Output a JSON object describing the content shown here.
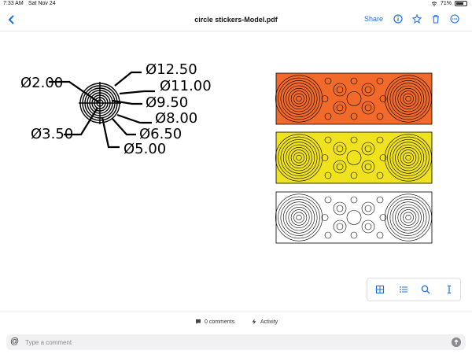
{
  "status_bar": {
    "time": "7:33 AM",
    "date": "Sat Nov 24",
    "battery": "71%",
    "battery_level": 0.71
  },
  "nav": {
    "title": "circle stickers-Model.pdf",
    "share_label": "Share"
  },
  "drawing": {
    "diameters": [
      "Ø2.00",
      "Ø3.50",
      "Ø5.00",
      "Ø6.50",
      "Ø8.00",
      "Ø9.50",
      "Ø11.00",
      "Ø12.50"
    ],
    "sticker_colors": [
      "#f26a2a",
      "#f0e21e",
      "#ffffff"
    ]
  },
  "footer": {
    "comments": "0 comments",
    "activity": "Activity"
  },
  "comment": {
    "placeholder": "Type a comment"
  },
  "colors": {
    "accent": "#1b6ef0"
  }
}
